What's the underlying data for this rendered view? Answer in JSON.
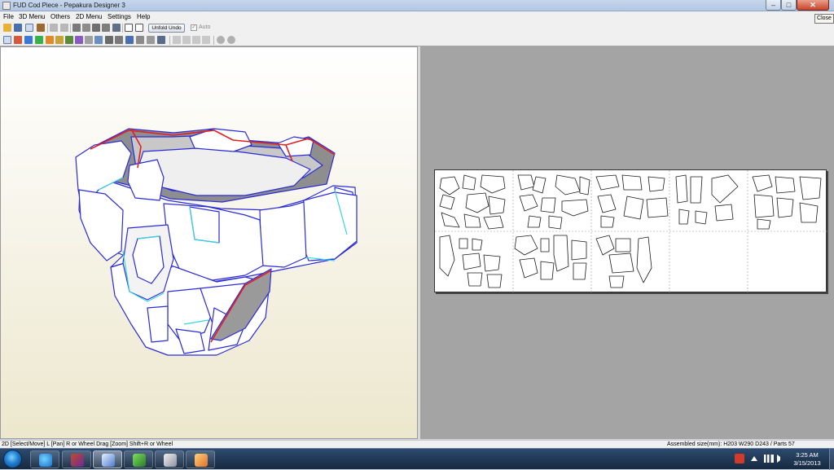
{
  "window": {
    "title": "FUD Cod Piece - Pepakura Designer 3",
    "minimize_label": "–",
    "maximize_label": "□",
    "close_label": "✕",
    "tooltip": "Close"
  },
  "menu": {
    "items": [
      "File",
      "3D Menu",
      "Others",
      "2D Menu",
      "Settings",
      "Help"
    ]
  },
  "toolbar": {
    "unfold_undo_label": "Unfold Undo",
    "auto_label": "Auto",
    "auto_checked": true
  },
  "status": {
    "left": "2D [Select/Move] L [Pan] R or Wheel Drag [Zoom] Shift+R or Wheel",
    "right": "Assembled size(mm): H203 W290 D243 / Parts 57"
  },
  "taskbar": {
    "clock_time": "3:25 AM",
    "clock_date": "3/15/2013",
    "apps": [
      "internet-explorer",
      "pepakura-viewer",
      "pepakura-designer",
      "notepad",
      "media-device",
      "paint-app"
    ]
  },
  "colors": {
    "model_edge_blue": "#2b2bd8",
    "model_edge_red": "#e02020",
    "model_edge_cyan": "#33d6e6",
    "paper_bg": "#a4a4a4"
  }
}
